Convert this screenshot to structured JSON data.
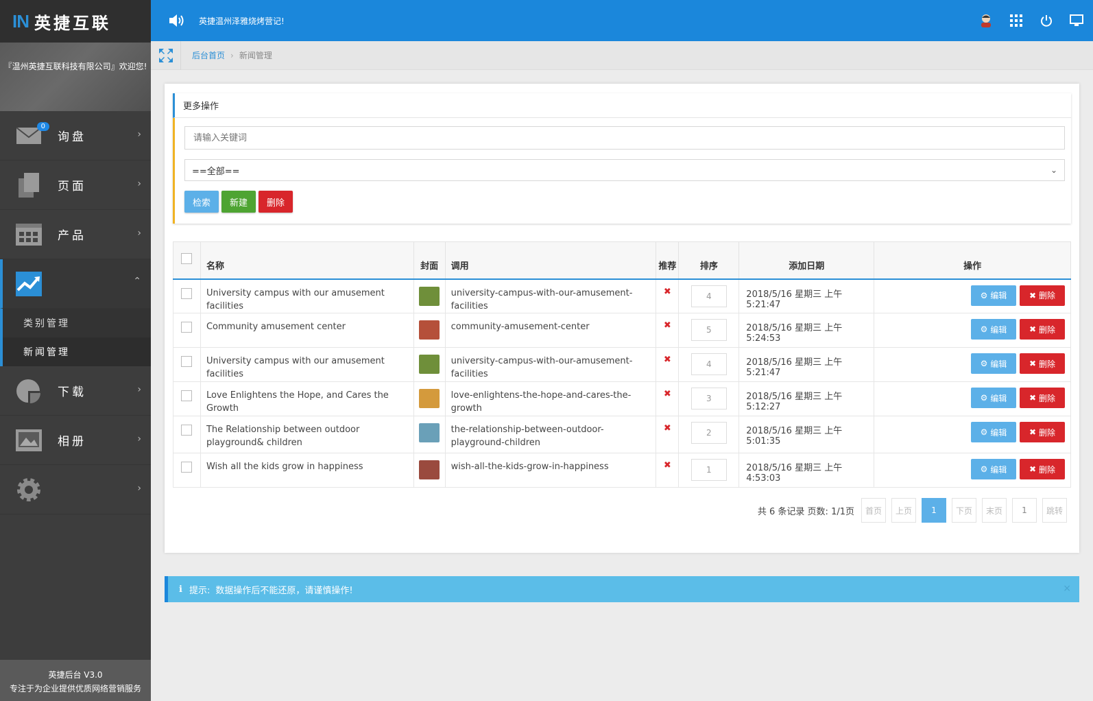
{
  "brand": {
    "logo_mark": "IN",
    "logo_text": "英捷互联",
    "welcome": "『温州英捷互联科技有限公司』欢迎您!"
  },
  "sidebar": {
    "items": [
      {
        "label": "询盘",
        "icon": "mail-icon",
        "badge": "0"
      },
      {
        "label": "页面",
        "icon": "pages-icon"
      },
      {
        "label": "产品",
        "icon": "product-icon"
      },
      {
        "label": "",
        "icon": "chart-icon"
      },
      {
        "label": "下载",
        "icon": "download-icon"
      },
      {
        "label": "相册",
        "icon": "album-icon"
      },
      {
        "label": "",
        "icon": "gear-icon"
      }
    ],
    "submenu": [
      {
        "label": "类别管理"
      },
      {
        "label": "新闻管理"
      }
    ],
    "footer_line1": "英捷后台 V3.0",
    "footer_line2": "专注于为企业提供优质网络营销服务"
  },
  "topbar": {
    "notice": "英捷温州泽雅烧烤营记!"
  },
  "breadcrumb": {
    "home": "后台首页",
    "separator": "›",
    "current": "新闻管理"
  },
  "ops": {
    "title": "更多操作",
    "search_placeholder": "请输入关键词",
    "select_value": "==全部==",
    "search_btn": "检索",
    "new_btn": "新建",
    "delete_btn": "删除"
  },
  "table": {
    "headers": {
      "name": "名称",
      "cover": "封面",
      "call": "调用",
      "recommend": "推荐",
      "order": "排序",
      "date": "添加日期",
      "actions": "操作"
    },
    "edit_label": "编辑",
    "delete_label": "删除",
    "rows": [
      {
        "name": "University campus with our amusement facilities",
        "slug": "university-campus-with-our-amusement-facilities",
        "order": "4",
        "date": "2018/5/16 星期三 上午 5:21:47",
        "thumb_color": "#6f8f3a"
      },
      {
        "name": "Community amusement center",
        "slug": "community-amusement-center",
        "order": "5",
        "date": "2018/5/16 星期三 上午 5:24:53",
        "thumb_color": "#b5503a"
      },
      {
        "name": "University campus with our amusement facilities",
        "slug": "university-campus-with-our-amusement-facilities",
        "order": "4",
        "date": "2018/5/16 星期三 上午 5:21:47",
        "thumb_color": "#6f8f3a"
      },
      {
        "name": "Love Enlightens the Hope, and Cares the Growth",
        "slug": "love-enlightens-the-hope-and-cares-the-growth",
        "order": "3",
        "date": "2018/5/16 星期三 上午 5:12:27",
        "thumb_color": "#d49a3c"
      },
      {
        "name": "The Relationship between outdoor playground& children",
        "slug": "the-relationship-between-outdoor-playground-children",
        "order": "2",
        "date": "2018/5/16 星期三 上午 5:01:35",
        "thumb_color": "#6aa0b8"
      },
      {
        "name": "Wish all the kids grow in happiness",
        "slug": "wish-all-the-kids-grow-in-happiness",
        "order": "1",
        "date": "2018/5/16 星期三 上午 4:53:03",
        "thumb_color": "#9a4a3e"
      }
    ]
  },
  "pager": {
    "info": "共 6 条记录 页数: 1/1页",
    "first": "首页",
    "prev": "上页",
    "current": "1",
    "next": "下页",
    "last": "末页",
    "jump_value": "1",
    "jump": "跳转"
  },
  "tip": {
    "label": "提示:",
    "text": "数据操作后不能还原，请谨慎操作!",
    "close": "×"
  },
  "colors": {
    "accent": "#1b87db",
    "danger": "#d8262b",
    "success": "#4ea432",
    "info": "#5cb0e8"
  }
}
